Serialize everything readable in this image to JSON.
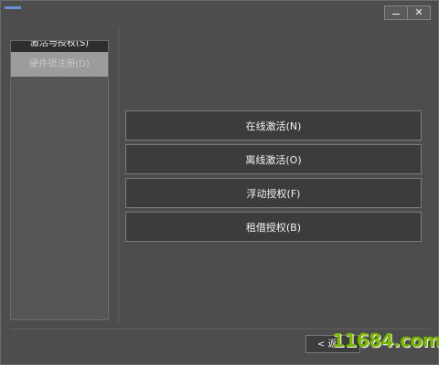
{
  "window": {
    "minimize_glyph": "—",
    "close_glyph": "✕"
  },
  "sidebar": {
    "items": [
      {
        "label": "激活与授权(S)",
        "state": "active"
      },
      {
        "label": "硬件锁注册(D)",
        "state": "disabled"
      }
    ]
  },
  "actions": [
    {
      "label": "在线激活(N)"
    },
    {
      "label": "离线激活(O)"
    },
    {
      "label": "浮动授权(F)"
    },
    {
      "label": "租借授权(B)"
    }
  ],
  "footer": {
    "back_label": "< 返"
  },
  "watermark": {
    "text": "11684.com"
  },
  "colors": {
    "background": "#4d4d4d",
    "button": "#3c3c3c",
    "watermark": "#7ab800"
  }
}
